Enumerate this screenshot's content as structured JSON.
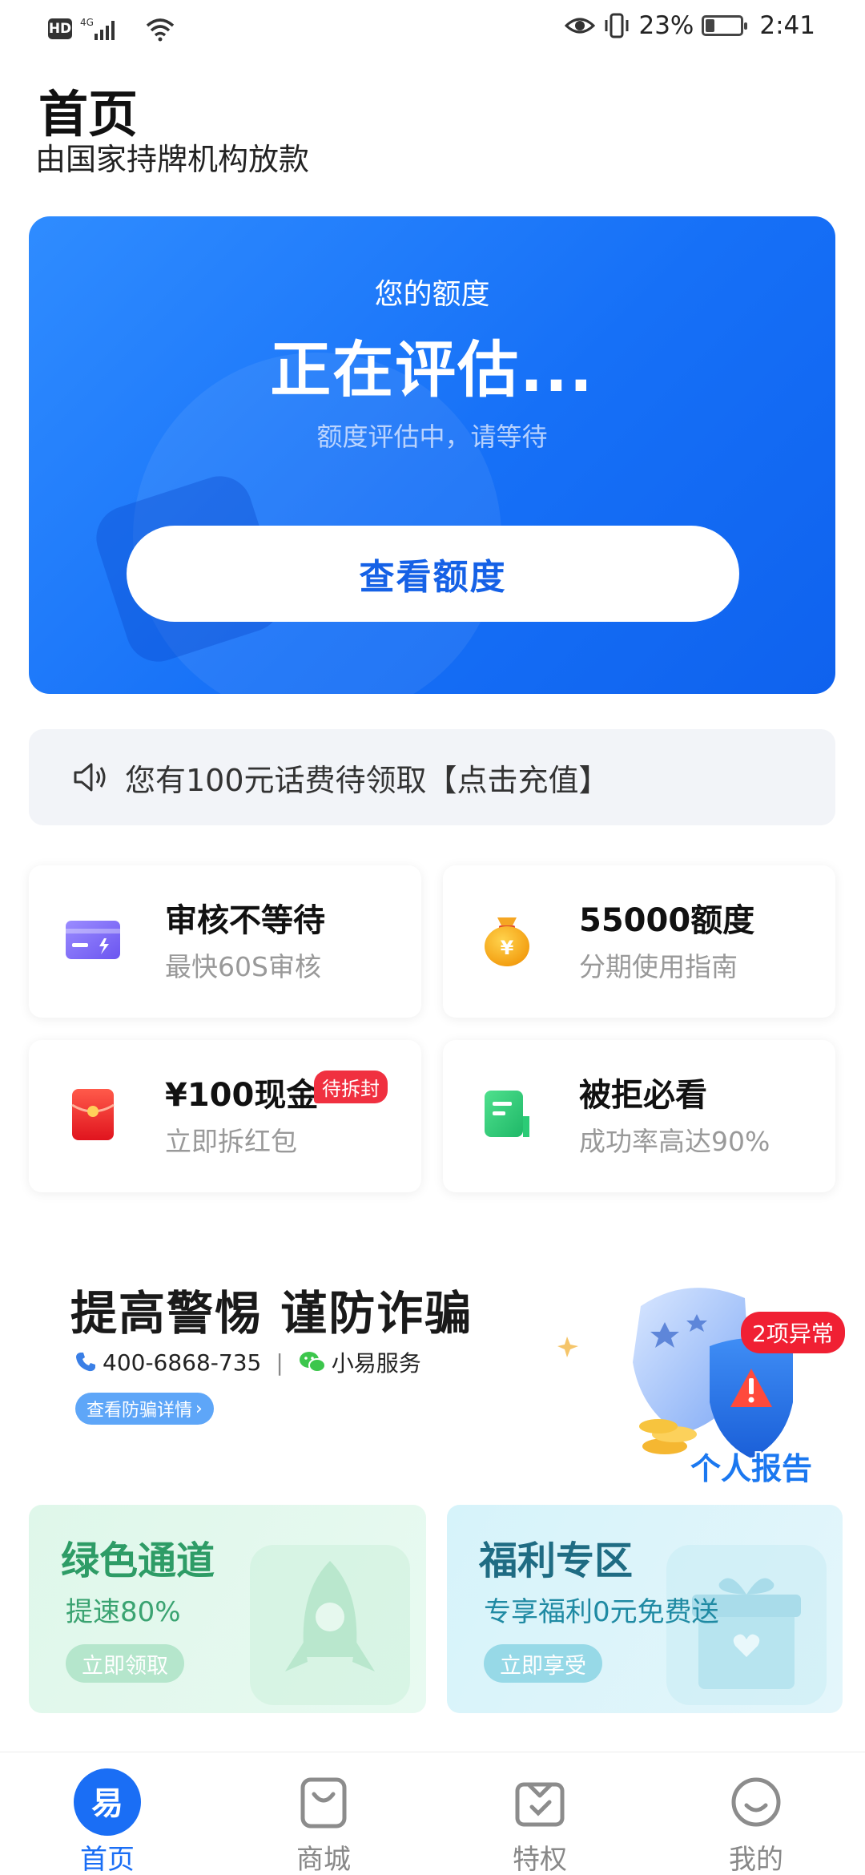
{
  "status_bar": {
    "hd": "HD",
    "network": "4G",
    "battery_percent": "23%",
    "battery_level": 0.23,
    "time": "2:41"
  },
  "header": {
    "title": "首页",
    "subtitle": "由国家持牌机构放款"
  },
  "credit_card": {
    "label": "您的额度",
    "status": "正在评估...",
    "note": "额度评估中，请等待",
    "button": "查看额度"
  },
  "notice": {
    "icon": "speaker-icon",
    "text": "您有100元话费待领取【点击充值】"
  },
  "features": [
    {
      "icon": "credit-card-icon",
      "title": "审核不等待",
      "subtitle": "最快60S审核",
      "badge": ""
    },
    {
      "icon": "money-bag-icon",
      "title": "55000额度",
      "subtitle": "分期使用指南",
      "badge": ""
    },
    {
      "icon": "red-envelope-icon",
      "title": "¥100现金",
      "subtitle": "立即拆红包",
      "badge": "待拆封"
    },
    {
      "icon": "document-icon",
      "title": "被拒必看",
      "subtitle": "成功率高达90%",
      "badge": ""
    }
  ],
  "anti_fraud": {
    "title": "提高警惕 谨防诈骗",
    "phone": "400-6868-735",
    "service": "小易服务",
    "button": "查看防骗详情",
    "report_badge": "2项异常",
    "report_label": "个人报告"
  },
  "promos": [
    {
      "title": "绿色通道",
      "subtitle": "提速80%",
      "button": "立即领取",
      "icon": "rocket-icon"
    },
    {
      "title": "福利专区",
      "subtitle": "专享福利0元免费送",
      "button": "立即享受",
      "icon": "gift-icon"
    }
  ],
  "bottom_nav": [
    {
      "label": "首页",
      "icon": "home-logo-icon",
      "active": true
    },
    {
      "label": "商城",
      "icon": "shopping-bag-icon",
      "active": false
    },
    {
      "label": "特权",
      "icon": "privilege-box-icon",
      "active": false
    },
    {
      "label": "我的",
      "icon": "smile-face-icon",
      "active": false
    }
  ],
  "colors": {
    "primary": "#1670f7",
    "badge_red": "#f03040",
    "green_text": "#2e9c66",
    "teal_text": "#1f6c83"
  }
}
